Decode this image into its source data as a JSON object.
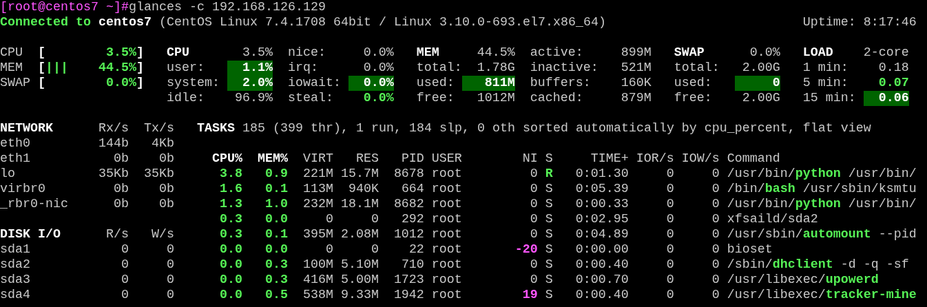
{
  "prompt": {
    "user_host": "[root@centos7 ~]#",
    "command": "glances -c 192.168.126.129"
  },
  "connection": {
    "status": "Connected to",
    "host": "centos7",
    "system": "(CentOS Linux 7.4.1708 64bit / Linux 3.10.0-693.el7.x86_64)",
    "uptime": "Uptime: 8:17:46"
  },
  "quicklook": [
    {
      "label": "CPU",
      "open": "[",
      "value": "3.5%",
      "close": "]",
      "ok": true
    },
    {
      "label": "MEM",
      "open": "[",
      "bars": "|||",
      "value": "44.5%",
      "close": "]",
      "ok": true
    },
    {
      "label": "SWAP",
      "open": "[",
      "value": "0.0%",
      "close": "]",
      "ok": true
    }
  ],
  "panels": [
    {
      "rows": [
        {
          "kind": "header",
          "label": "CPU",
          "value": "3.5%",
          "ok": false,
          "logged": false
        },
        {
          "kind": "stat",
          "label": "user:",
          "value": "1.1%",
          "ok": true,
          "logged": true
        },
        {
          "kind": "stat",
          "label": "system:",
          "value": "2.0%",
          "ok": true,
          "logged": true
        },
        {
          "kind": "stat",
          "label": "idle:",
          "value": "96.9%",
          "ok": false,
          "logged": false
        }
      ]
    },
    {
      "rows": [
        {
          "kind": "stat",
          "label": "nice:",
          "value": "0.0%",
          "ok": false,
          "logged": false
        },
        {
          "kind": "stat",
          "label": "irq:",
          "value": "0.0%",
          "ok": false,
          "logged": false
        },
        {
          "kind": "stat",
          "label": "iowait:",
          "value": "0.0%",
          "ok": true,
          "logged": true
        },
        {
          "kind": "stat",
          "label": "steal:",
          "value": "0.0%",
          "ok": true,
          "logged": false
        }
      ]
    },
    {
      "rows": [
        {
          "kind": "header",
          "label": "MEM",
          "value": "44.5%",
          "ok": false,
          "logged": false
        },
        {
          "kind": "stat",
          "label": "total:",
          "value": "1.78G",
          "ok": false,
          "logged": false
        },
        {
          "kind": "stat",
          "label": "used:",
          "value": "811M",
          "ok": true,
          "logged": true
        },
        {
          "kind": "stat",
          "label": "free:",
          "value": "1012M",
          "ok": false,
          "logged": false
        }
      ]
    },
    {
      "rows": [
        {
          "kind": "stat",
          "label": "active:",
          "value": "899M",
          "ok": false,
          "logged": false
        },
        {
          "kind": "stat",
          "label": "inactive:",
          "value": "521M",
          "ok": false,
          "logged": false
        },
        {
          "kind": "stat",
          "label": "buffers:",
          "value": "160K",
          "ok": false,
          "logged": false
        },
        {
          "kind": "stat",
          "label": "cached:",
          "value": "879M",
          "ok": false,
          "logged": false
        }
      ]
    },
    {
      "rows": [
        {
          "kind": "header",
          "label": "SWAP",
          "value": "0.0%",
          "ok": false,
          "logged": false
        },
        {
          "kind": "stat",
          "label": "total:",
          "value": "2.00G",
          "ok": false,
          "logged": false
        },
        {
          "kind": "stat",
          "label": "used:",
          "value": "0",
          "ok": true,
          "logged": true
        },
        {
          "kind": "stat",
          "label": "free:",
          "value": "2.00G",
          "ok": false,
          "logged": false
        }
      ]
    },
    {
      "rows": [
        {
          "kind": "header",
          "label": "LOAD",
          "value": "2-core",
          "ok": false,
          "logged": false
        },
        {
          "kind": "stat",
          "label": "1 min:",
          "value": "0.18",
          "ok": false,
          "logged": false
        },
        {
          "kind": "stat",
          "label": "5 min:",
          "value": "0.07",
          "ok": true,
          "logged": false
        },
        {
          "kind": "stat",
          "label": "15 min:",
          "value": "0.06",
          "ok": true,
          "logged": true
        }
      ]
    }
  ],
  "network": {
    "title": "NETWORK",
    "rx": "Rx/s",
    "tx": "Tx/s",
    "rows": [
      {
        "name": "eth0",
        "rx": "144b",
        "tx": "4Kb"
      },
      {
        "name": "eth1",
        "rx": "0b",
        "tx": "0b"
      },
      {
        "name": "lo",
        "rx": "35Kb",
        "tx": "35Kb"
      },
      {
        "name": "virbr0",
        "rx": "0b",
        "tx": "0b"
      },
      {
        "name": "_rbr0-nic",
        "rx": "0b",
        "tx": "0b"
      }
    ]
  },
  "disk": {
    "title": "DISK I/O",
    "read": "R/s",
    "write": "W/s",
    "rows": [
      {
        "name": "sda1",
        "read": "0",
        "write": "0"
      },
      {
        "name": "sda2",
        "read": "0",
        "write": "0"
      },
      {
        "name": "sda3",
        "read": "0",
        "write": "0"
      },
      {
        "name": "sda4",
        "read": "0",
        "write": "0"
      }
    ]
  },
  "tasks": "**TASKS** 185 (399 thr), 1 run, 184 slp, 0 oth sorted automatically by cpu_percent, flat view",
  "columns": [
    "CPU%",
    "MEM%",
    "VIRT",
    "RES",
    "PID",
    "USER",
    "NI",
    "S",
    "TIME+",
    "IOR/s",
    "IOW/s",
    "Command"
  ],
  "processes": [
    {
      "cpu": "3.8",
      "mem": "0.9",
      "virt": "221M",
      "res": "15.7M",
      "pid": "8678",
      "user": "root",
      "ni": "0",
      "niced": false,
      "state": "R",
      "running": true,
      "time": "0:01.30",
      "ior": "0",
      "iow": "0",
      "command": "/usr/bin/**python** /usr/bin/",
      "cpu_ok": true,
      "mem_ok": true
    },
    {
      "cpu": "1.6",
      "mem": "0.1",
      "virt": "113M",
      "res": "940K",
      "pid": "664",
      "user": "root",
      "ni": "0",
      "niced": false,
      "state": "S",
      "running": false,
      "time": "0:05.39",
      "ior": "0",
      "iow": "0",
      "command": "/bin/**bash** /usr/sbin/ksmtu",
      "cpu_ok": true,
      "mem_ok": true
    },
    {
      "cpu": "1.3",
      "mem": "1.0",
      "virt": "232M",
      "res": "18.1M",
      "pid": "8682",
      "user": "root",
      "ni": "0",
      "niced": false,
      "state": "S",
      "running": false,
      "time": "0:00.33",
      "ior": "0",
      "iow": "0",
      "command": "/usr/bin/**python** /usr/bin/",
      "cpu_ok": true,
      "mem_ok": true
    },
    {
      "cpu": "0.3",
      "mem": "0.0",
      "virt": "0",
      "res": "0",
      "pid": "292",
      "user": "root",
      "ni": "0",
      "niced": false,
      "state": "S",
      "running": false,
      "time": "0:02.95",
      "ior": "0",
      "iow": "0",
      "command": "xfsaild/sda2",
      "cpu_ok": true,
      "mem_ok": true
    },
    {
      "cpu": "0.3",
      "mem": "0.1",
      "virt": "395M",
      "res": "2.08M",
      "pid": "1012",
      "user": "root",
      "ni": "0",
      "niced": false,
      "state": "S",
      "running": false,
      "time": "0:04.89",
      "ior": "0",
      "iow": "0",
      "command": "/usr/sbin/**automount** --pid",
      "cpu_ok": true,
      "mem_ok": true
    },
    {
      "cpu": "0.0",
      "mem": "0.0",
      "virt": "0",
      "res": "0",
      "pid": "22",
      "user": "root",
      "ni": "-20",
      "niced": true,
      "state": "S",
      "running": false,
      "time": "0:00.00",
      "ior": "0",
      "iow": "0",
      "command": "bioset",
      "cpu_ok": true,
      "mem_ok": true
    },
    {
      "cpu": "0.0",
      "mem": "0.3",
      "virt": "100M",
      "res": "5.10M",
      "pid": "710",
      "user": "root",
      "ni": "0",
      "niced": false,
      "state": "S",
      "running": false,
      "time": "0:00.40",
      "ior": "0",
      "iow": "0",
      "command": "/sbin/**dhclient** -d -q -sf",
      "cpu_ok": true,
      "mem_ok": true
    },
    {
      "cpu": "0.0",
      "mem": "0.3",
      "virt": "416M",
      "res": "5.00M",
      "pid": "1723",
      "user": "root",
      "ni": "0",
      "niced": false,
      "state": "S",
      "running": false,
      "time": "0:00.70",
      "ior": "0",
      "iow": "0",
      "command": "/usr/libexec/**upowerd**",
      "cpu_ok": true,
      "mem_ok": true
    },
    {
      "cpu": "0.0",
      "mem": "0.5",
      "virt": "538M",
      "res": "9.33M",
      "pid": "1942",
      "user": "root",
      "ni": "19",
      "niced": true,
      "state": "S",
      "running": false,
      "time": "0:00.40",
      "ior": "0",
      "iow": "0",
      "command": "/usr/libexec/**tracker-mine**",
      "cpu_ok": true,
      "mem_ok": true
    }
  ]
}
